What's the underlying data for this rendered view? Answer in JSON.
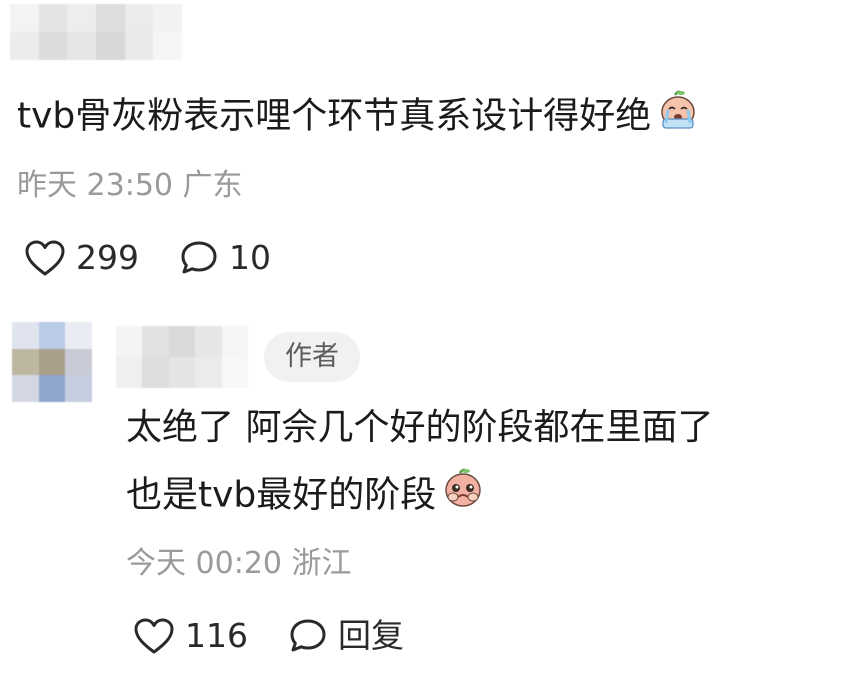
{
  "top_comment": {
    "text": "tvb骨灰粉表示哩个环节真系设计得好绝",
    "emoji": "crying-peach-emoji",
    "meta": "昨天 23:50 广东",
    "like_count": "299",
    "reply_count": "10"
  },
  "reply": {
    "author_badge": "作者",
    "text_line1": "太绝了 阿佘几个好的阶段都在里面了",
    "text_line2": "也是tvb最好的阶段",
    "emoji": "pleading-peach-emoji",
    "meta": "今天 00:20 浙江",
    "like_count": "116",
    "reply_label": "回复"
  },
  "colors": {
    "text": "#1b1b1b",
    "meta": "#9a9a9a",
    "badge_bg": "#f1f1f1",
    "badge_text": "#5c5c5c"
  },
  "icons": {
    "like": "heart-outline-icon",
    "comment": "speech-bubble-icon"
  }
}
